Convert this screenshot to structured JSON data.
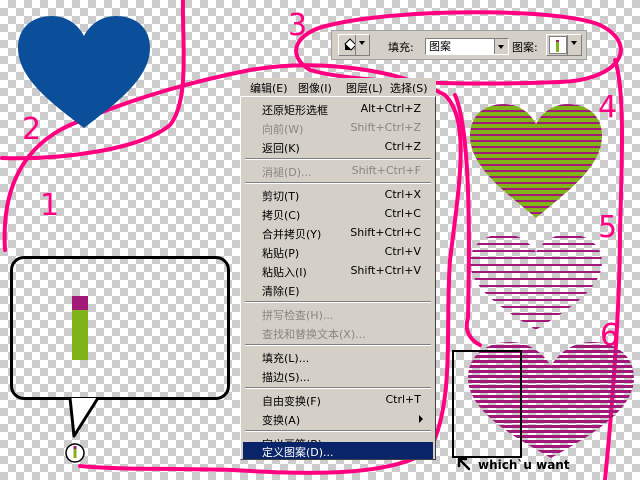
{
  "annotations": {
    "numbers": [
      "3",
      "2",
      "1",
      "4",
      "5",
      "6"
    ],
    "caption": "which`u want"
  },
  "colors": {
    "annotation": "#ff0080",
    "heart_blue": "#0b4f9b",
    "heart_green": "#80b21a",
    "heart_magenta": "#a2197a",
    "menu_bg": "#d4d0c8",
    "selection": "#0a246a"
  },
  "toolbar": {
    "paint_bucket_icon": "paint-bucket-icon",
    "fill_label": "填充:",
    "fill_value": "图案",
    "pattern_label": "图案:"
  },
  "menubar": {
    "items": [
      "编辑(E)",
      "图像(I)",
      "图层(L)",
      "选择(S)"
    ]
  },
  "menu": {
    "items": [
      {
        "label": "还原矩形选框",
        "shortcut": "Alt+Ctrl+Z",
        "disabled": false
      },
      {
        "label": "向前(W)",
        "shortcut": "Shift+Ctrl+Z",
        "disabled": true
      },
      {
        "label": "返回(K)",
        "shortcut": "Ctrl+Z",
        "disabled": false
      },
      {
        "label": "消褪(D)...",
        "shortcut": "Shift+Ctrl+F",
        "disabled": true
      },
      {
        "label": "剪切(T)",
        "shortcut": "Ctrl+X",
        "disabled": false
      },
      {
        "label": "拷贝(C)",
        "shortcut": "Ctrl+C",
        "disabled": false
      },
      {
        "label": "合并拷贝(Y)",
        "shortcut": "Shift+Ctrl+C",
        "disabled": false
      },
      {
        "label": "粘贴(P)",
        "shortcut": "Ctrl+V",
        "disabled": false
      },
      {
        "label": "粘贴入(I)",
        "shortcut": "Shift+Ctrl+V",
        "disabled": false
      },
      {
        "label": "清除(E)",
        "shortcut": "",
        "disabled": false
      },
      {
        "label": "拼写检查(H)...",
        "shortcut": "",
        "disabled": true
      },
      {
        "label": "查找和替换文本(X)...",
        "shortcut": "",
        "disabled": true
      },
      {
        "label": "填充(L)...",
        "shortcut": "",
        "disabled": false
      },
      {
        "label": "描边(S)...",
        "shortcut": "",
        "disabled": false
      },
      {
        "label": "自由变换(F)",
        "shortcut": "Ctrl+T",
        "disabled": false
      },
      {
        "label": "变换(A)",
        "shortcut": "",
        "disabled": false,
        "submenu": true
      },
      {
        "label": "定义画笔(B)...",
        "shortcut": "",
        "disabled": false
      },
      {
        "label": "定义图案(D)...",
        "shortcut": "",
        "disabled": false,
        "selected": true
      }
    ]
  }
}
